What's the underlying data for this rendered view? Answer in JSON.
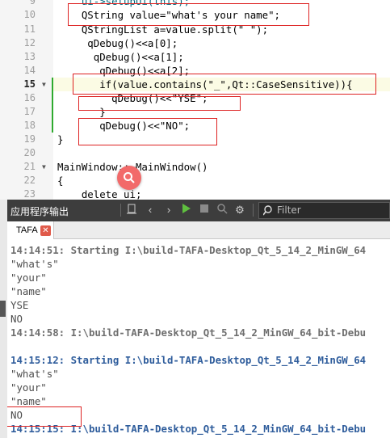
{
  "editor": {
    "lines": [
      {
        "num": "9",
        "text": "    ui->setupUi(this);"
      },
      {
        "num": "10",
        "text": "    QString value=\"what's your name\";"
      },
      {
        "num": "11",
        "text": "    QStringList a=value.split(\" \");"
      },
      {
        "num": "12",
        "text": "     qDebug()<<a[0];"
      },
      {
        "num": "13",
        "text": "      qDebug()<<a[1];"
      },
      {
        "num": "14",
        "text": "       qDebug()<<a[2];"
      },
      {
        "num": "15",
        "text": "       if(value.contains(\"_\",Qt::CaseSensitive)){"
      },
      {
        "num": "16",
        "text": "         qDebug()<<\"YSE\";"
      },
      {
        "num": "17",
        "text": "       }"
      },
      {
        "num": "18",
        "text": "       qDebug()<<\"NO\";"
      },
      {
        "num": "19",
        "text": "}"
      },
      {
        "num": "20",
        "text": ""
      },
      {
        "num": "21",
        "text": "MainWindow::~MainWindow()"
      },
      {
        "num": "22",
        "text": "{"
      },
      {
        "num": "23",
        "text": "    delete ui;"
      }
    ]
  },
  "output_pane": {
    "title": "应用程序输出",
    "filter_placeholder": "Filter",
    "tab_label": "TAFA",
    "lines": [
      {
        "text": "14:14:51: Starting I:\\build-TAFA-Desktop_Qt_5_14_2_MinGW_64",
        "style": "gray"
      },
      {
        "text": "\"what's\"",
        "style": "plain"
      },
      {
        "text": "\"your\"",
        "style": "plain"
      },
      {
        "text": "\"name\"",
        "style": "plain"
      },
      {
        "text": "YSE",
        "style": "plain"
      },
      {
        "text": "NO",
        "style": "plain"
      },
      {
        "text": "14:14:58: I:\\build-TAFA-Desktop_Qt_5_14_2_MinGW_64_bit-Debu",
        "style": "gray"
      },
      {
        "text": "",
        "style": "plain"
      },
      {
        "text": "14:15:12: Starting I:\\build-TAFA-Desktop_Qt_5_14_2_MinGW_64",
        "style": "blue"
      },
      {
        "text": "\"what's\"",
        "style": "plain"
      },
      {
        "text": "\"your\"",
        "style": "plain"
      },
      {
        "text": "\"name\"",
        "style": "plain"
      },
      {
        "text": "NO",
        "style": "plain"
      },
      {
        "text": "14:15:15: I:\\build-TAFA-Desktop_Qt_5_14_2_MinGW_64_bit-Debu",
        "style": "blue"
      }
    ]
  },
  "icons": {
    "search_fab": "search-icon",
    "toolbar": [
      "clear-icon",
      "previous-icon",
      "next-icon",
      "run-icon",
      "stop-icon",
      "zoom-icon",
      "settings-icon",
      "filter-search-icon"
    ]
  },
  "colors": {
    "highlight_box": "#dd2222",
    "keyword": "#808000",
    "string": "#008000",
    "type": "#800080",
    "output_blue": "#2f5d9c"
  }
}
